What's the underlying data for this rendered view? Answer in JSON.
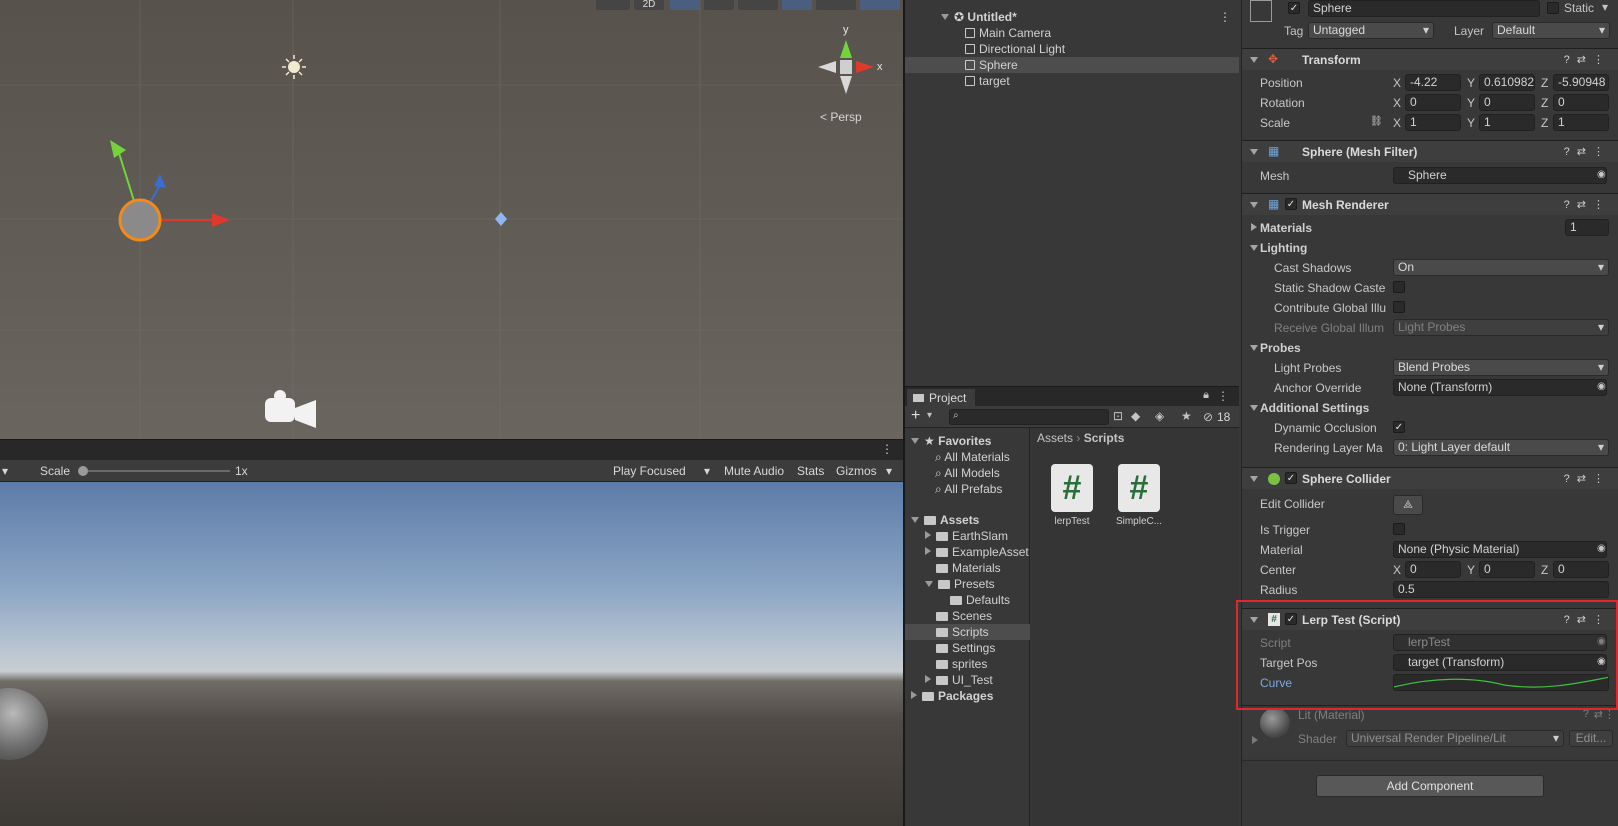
{
  "scene": {
    "persp_label": "Persp",
    "axis_labels": {
      "y": "y",
      "x": "x"
    },
    "toolbar_2d": "2D"
  },
  "game_bar": {
    "scale_label": "Scale",
    "scale_value": "1x",
    "play_focused": "Play Focused",
    "mute_audio": "Mute Audio",
    "stats": "Stats",
    "gizmos": "Gizmos"
  },
  "hierarchy": {
    "scene_name": "Untitled*",
    "items": [
      "Main Camera",
      "Directional Light",
      "Sphere",
      "target"
    ],
    "selected": "Sphere"
  },
  "project": {
    "tab": "Project",
    "hidden_count": "18",
    "tree": {
      "favorites": "Favorites",
      "fav_items": [
        "All Materials",
        "All Models",
        "All Prefabs"
      ],
      "assets": "Assets",
      "asset_items": [
        "EarthSlam",
        "ExampleAsset",
        "Materials",
        "Presets",
        "Defaults",
        "Scenes",
        "Scripts",
        "Settings",
        "sprites",
        "UI_Test"
      ],
      "packages": "Packages"
    },
    "breadcrumb": [
      "Assets",
      "Scripts"
    ],
    "files": [
      {
        "name": "lerpTest",
        "glyph": "#"
      },
      {
        "name": "SimpleC...",
        "glyph": "#"
      }
    ]
  },
  "inspector": {
    "object_name": "Sphere",
    "static_label": "Static",
    "tag_label": "Tag",
    "tag_value": "Untagged",
    "layer_label": "Layer",
    "layer_value": "Default",
    "transform": {
      "title": "Transform",
      "position_label": "Position",
      "position": {
        "x": "-4.22",
        "y": "0.610982",
        "z": "-5.90948"
      },
      "rotation_label": "Rotation",
      "rotation": {
        "x": "0",
        "y": "0",
        "z": "0"
      },
      "scale_label": "Scale",
      "scale": {
        "x": "1",
        "y": "1",
        "z": "1"
      }
    },
    "mesh_filter": {
      "title": "Sphere (Mesh Filter)",
      "mesh_label": "Mesh",
      "mesh_value": "Sphere"
    },
    "mesh_renderer": {
      "title": "Mesh Renderer",
      "materials_label": "Materials",
      "materials_count": "1",
      "lighting_label": "Lighting",
      "cast_shadows_label": "Cast Shadows",
      "cast_shadows_value": "On",
      "static_shadow_label": "Static Shadow Caste",
      "contribute_gi_label": "Contribute Global Illu",
      "receive_gi_label": "Receive Global Illum",
      "receive_gi_value": "Light Probes",
      "probes_label": "Probes",
      "light_probes_label": "Light Probes",
      "light_probes_value": "Blend Probes",
      "anchor_label": "Anchor Override",
      "anchor_value": "None (Transform)",
      "additional_label": "Additional Settings",
      "dynamic_occlusion_label": "Dynamic Occlusion",
      "rendering_layer_label": "Rendering Layer Ma",
      "rendering_layer_value": "0: Light Layer default"
    },
    "sphere_collider": {
      "title": "Sphere Collider",
      "edit_label": "Edit Collider",
      "trigger_label": "Is Trigger",
      "material_label": "Material",
      "material_value": "None (Physic Material)",
      "center_label": "Center",
      "center": {
        "x": "0",
        "y": "0",
        "z": "0"
      },
      "radius_label": "Radius",
      "radius_value": "0.5"
    },
    "lerp_test": {
      "title": "Lerp Test (Script)",
      "script_label": "Script",
      "script_value": "lerpTest",
      "target_label": "Target Pos",
      "target_value": "target (Transform)",
      "curve_label": "Curve"
    },
    "material": {
      "title": "Lit (Material)",
      "shader_label": "Shader",
      "shader_value": "Universal Render Pipeline/Lit",
      "edit_label": "Edit..."
    },
    "add_component": "Add Component"
  },
  "colors": {
    "highlight": "#e0262f",
    "curve": "#3fbf3f",
    "selection": "#4d4d4d"
  }
}
